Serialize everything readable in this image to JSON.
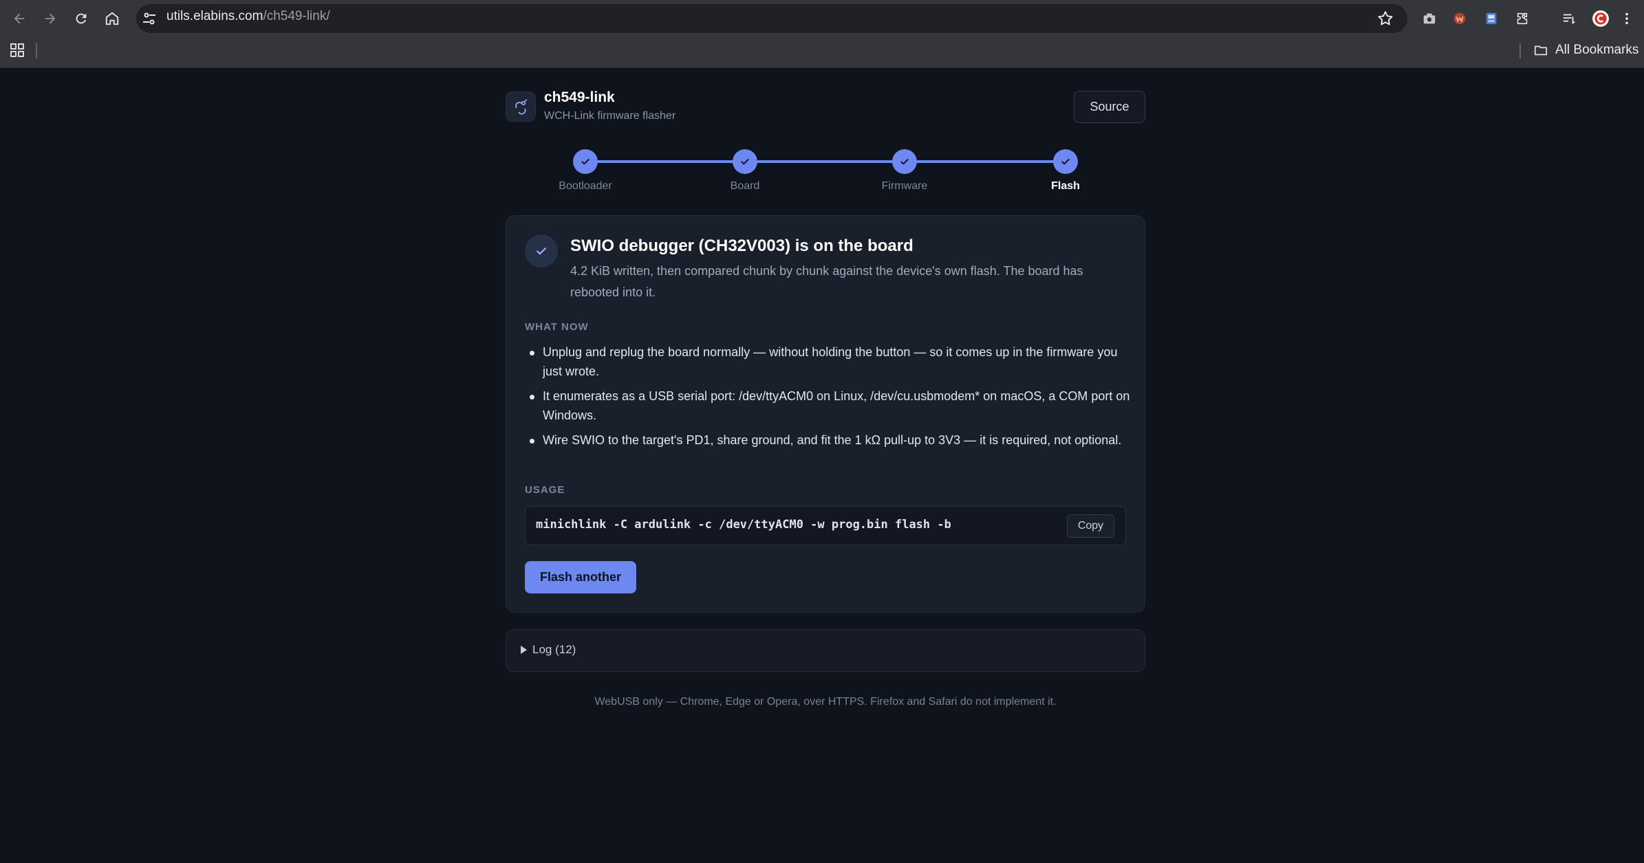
{
  "browser": {
    "url_host": "utils.elabins.com",
    "url_path": "/ch549-link/",
    "bookmarks_label": "All Bookmarks"
  },
  "app": {
    "title": "ch549-link",
    "subtitle": "WCH-Link firmware flasher",
    "source_label": "Source"
  },
  "steps": [
    {
      "label": "Bootloader",
      "done": true
    },
    {
      "label": "Board",
      "done": true
    },
    {
      "label": "Firmware",
      "done": true
    },
    {
      "label": "Flash",
      "done": true,
      "active": true
    }
  ],
  "result": {
    "title": "SWIO debugger (CH32V003) is on the board",
    "description": "4.2 KiB written, then compared chunk by chunk against the device's own flash. The board has rebooted into it.",
    "what_now_label": "WHAT NOW",
    "bullets": [
      "Unplug and replug the board normally — without holding the button — so it comes up in the firmware you just wrote.",
      "It enumerates as a USB serial port: /dev/ttyACM0 on Linux, /dev/cu.usbmodem* on macOS, a COM port on Windows.",
      "Wire SWIO to the target's PD1, share ground, and fit the 1 kΩ pull-up to 3V3 — it is required, not optional."
    ],
    "usage_label": "USAGE",
    "usage_command": "minichlink -C ardulink -c /dev/ttyACM0 -w prog.bin flash -b",
    "copy_label": "Copy",
    "flash_another_label": "Flash another"
  },
  "log": {
    "label": "Log (12)"
  },
  "footer": "WebUSB only — Chrome, Edge or Opera, over HTTPS. Firefox and Safari do not implement it.",
  "colors": {
    "accent": "#6d88f0",
    "page_bg": "#0f131c",
    "card_bg": "#1a1f2c"
  }
}
